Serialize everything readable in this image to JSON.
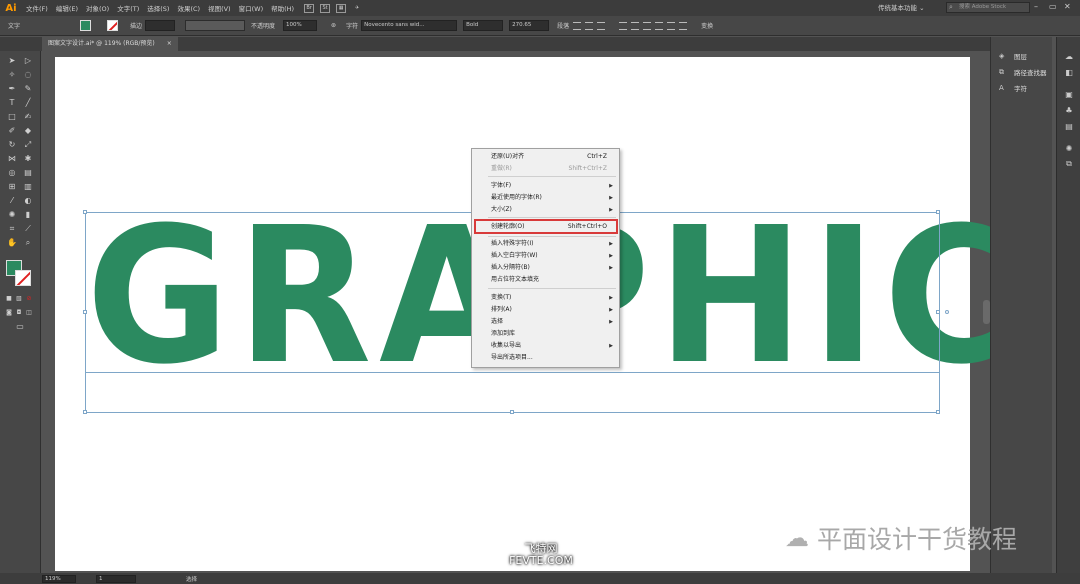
{
  "menubar": {
    "logo": "Ai",
    "items": [
      "文件(F)",
      "编辑(E)",
      "对象(O)",
      "文字(T)",
      "选择(S)",
      "效果(C)",
      "视图(V)",
      "窗口(W)",
      "帮助(H)"
    ],
    "icons": [
      "Br",
      "St"
    ],
    "workspace": "传统基本功能 ⌄",
    "stock_search_placeholder": "搜索 Adobe Stock"
  },
  "controlbar": {
    "tool_label": "文字",
    "stroke_label": "描边",
    "opacity_label": "不透明度",
    "opacity_value": "100%",
    "char_label": "字符",
    "font_value": "Novecento sans wid...",
    "weight_value": "Bold",
    "size_value": "270.65",
    "paragraph_label": "段落",
    "transform_label": "变换"
  },
  "tab": {
    "title": "图案文字设计.ai* @ 119% (RGB/预览)",
    "close": "×"
  },
  "canvas": {
    "text": "GRAPHIC",
    "text_color": "#2b8a60"
  },
  "context_menu": {
    "items": [
      {
        "label": "还原(U)对齐",
        "shortcut": "Ctrl+Z",
        "disabled": false,
        "submenu": false
      },
      {
        "label": "重做(R)",
        "shortcut": "Shift+Ctrl+Z",
        "disabled": true,
        "submenu": false
      },
      {
        "label": "字体(F)",
        "shortcut": "",
        "disabled": false,
        "submenu": true
      },
      {
        "label": "最近使用的字体(R)",
        "shortcut": "",
        "disabled": false,
        "submenu": true
      },
      {
        "label": "大小(Z)",
        "shortcut": "",
        "disabled": false,
        "submenu": true
      },
      {
        "label": "创建轮廓(O)",
        "shortcut": "Shift+Ctrl+O",
        "disabled": false,
        "submenu": false
      },
      {
        "label": "插入特殊字符(I)",
        "shortcut": "",
        "disabled": false,
        "submenu": true
      },
      {
        "label": "插入空白字符(W)",
        "shortcut": "",
        "disabled": false,
        "submenu": true
      },
      {
        "label": "插入分隔符(B)",
        "shortcut": "",
        "disabled": false,
        "submenu": true
      },
      {
        "label": "用占位符文本填充",
        "shortcut": "",
        "disabled": false,
        "submenu": false
      },
      {
        "label": "变换(T)",
        "shortcut": "",
        "disabled": false,
        "submenu": true
      },
      {
        "label": "排列(A)",
        "shortcut": "",
        "disabled": false,
        "submenu": true
      },
      {
        "label": "选择",
        "shortcut": "",
        "disabled": false,
        "submenu": true
      },
      {
        "label": "添加到库",
        "shortcut": "",
        "disabled": false,
        "submenu": false
      },
      {
        "label": "收集以导出",
        "shortcut": "",
        "disabled": false,
        "submenu": true
      },
      {
        "label": "导出所选项目...",
        "shortcut": "",
        "disabled": false,
        "submenu": false
      }
    ],
    "highlighted_index": 5
  },
  "right_panel": {
    "items": [
      "图层",
      "路径查找器",
      "字符"
    ]
  },
  "statusbar": {
    "zoom": "119%",
    "artboard": "1",
    "tool": "选择"
  },
  "watermarks": {
    "wechat": "平面设计干货教程",
    "site_cn": "飞特网",
    "site_en": "FEVTE.COM"
  }
}
